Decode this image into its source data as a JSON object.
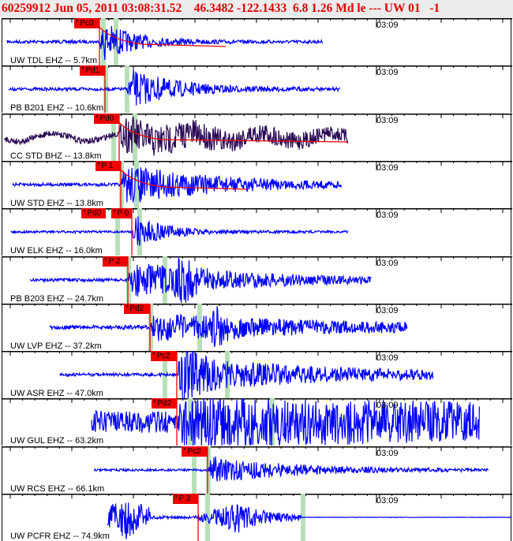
{
  "header": {
    "event_line": "60259912 Jun 05, 2011 03:08:31.52    46.3482 -122.1433  6.8 1.26 Md le --- UW 01   -1"
  },
  "colors": {
    "trace": "#0000ff",
    "broadband_trace": "#2a0a55",
    "pick": "#f00000",
    "marker": "#b8e0b8",
    "header_text": "#e00000"
  },
  "time_marker": "03:09",
  "traces": [
    {
      "label": "UW TDL EHZ -- 5.7km",
      "picks": [
        "Pc0"
      ]
    },
    {
      "label": "PB B201 EHZ -- 10.6km",
      "picks": [
        "Pd1"
      ]
    },
    {
      "label": "CC STD BHZ -- 13.8km",
      "picks": [
        "Pd0"
      ]
    },
    {
      "label": "UW STD EHZ -- 13.8km",
      "picks": [
        "P 1"
      ]
    },
    {
      "label": "UW ELK EHZ -- 16.0km",
      "picks": [
        "Pd0",
        "P 0"
      ]
    },
    {
      "label": "PB B203 EHZ -- 24.7km",
      "picks": [
        "P 2"
      ]
    },
    {
      "label": "UW LVP EHZ -- 37.2km",
      "picks": [
        "Pd2"
      ]
    },
    {
      "label": "UW ASR EHZ -- 47.0km",
      "picks": [
        "Pc2"
      ]
    },
    {
      "label": "UW GUL EHZ -- 63.2km",
      "picks": [
        "Pd2"
      ]
    },
    {
      "label": "UW RCS EHZ -- 66.1km",
      "picks": [
        "Pc2"
      ]
    },
    {
      "label": "UW PCFR EHZ -- 74.9km",
      "picks": [
        "P 3"
      ]
    }
  ]
}
